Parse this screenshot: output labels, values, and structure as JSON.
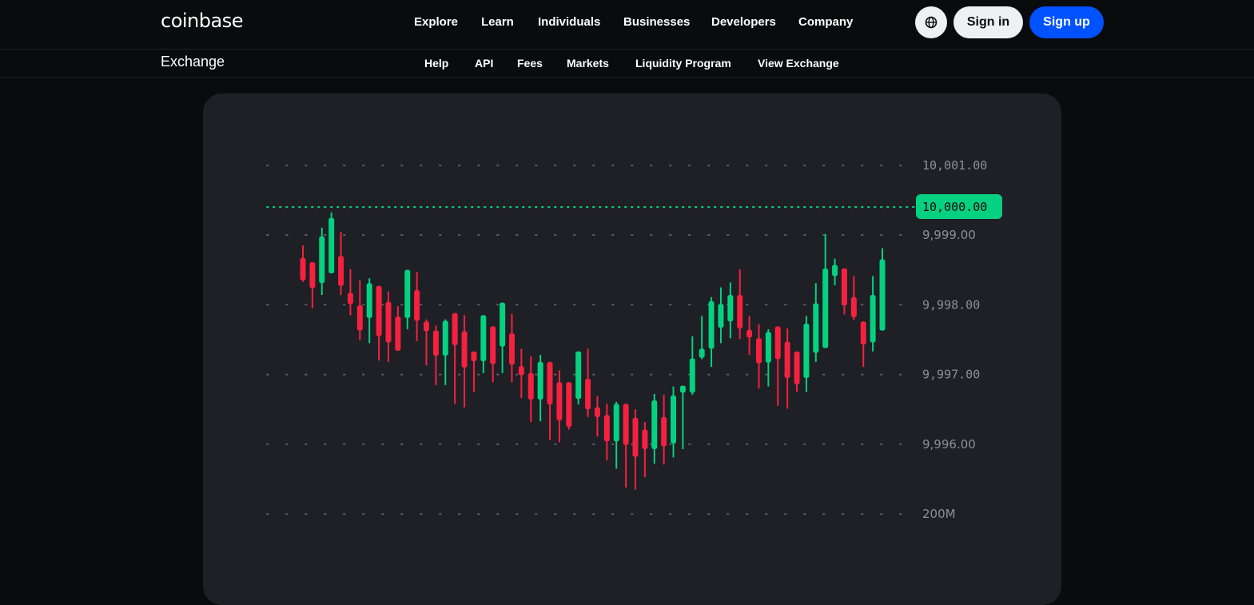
{
  "header": {
    "logo": "coinbase",
    "nav": [
      "Explore",
      "Learn",
      "Individuals",
      "Businesses",
      "Developers",
      "Company"
    ],
    "globe_icon": "globe-icon",
    "sign_in": "Sign in",
    "sign_up": "Sign up"
  },
  "subnav": {
    "title": "Exchange",
    "links": [
      "Help",
      "API",
      "Fees",
      "Markets",
      "Liquidity Program",
      "View Exchange"
    ]
  },
  "colors": {
    "up": "#05d180",
    "down": "#f5213f",
    "accent": "#0052ff",
    "price_marker": "#05d180"
  },
  "chart_data": {
    "type": "candlestick",
    "title": "",
    "yaxis_ticks": [
      {
        "value": 10001.0,
        "label": "10,001.00"
      },
      {
        "value": 9999.0,
        "label": "9,999.00"
      },
      {
        "value": 9998.0,
        "label": "9,998.00"
      },
      {
        "value": 9997.0,
        "label": "9,997.00"
      },
      {
        "value": 9996.0,
        "label": "9,996.00"
      },
      {
        "value": 9995.0,
        "label": "200M"
      }
    ],
    "current_price": {
      "value": 9999.4,
      "label": "10,000.00"
    },
    "ylim": [
      9994.8,
      10001.5
    ],
    "grid": "dotted",
    "candles": [
      {
        "o": 9998.67,
        "h": 9998.85,
        "l": 9998.33,
        "c": 9998.35
      },
      {
        "o": 9998.61,
        "h": 9998.61,
        "l": 9997.95,
        "c": 9998.24
      },
      {
        "o": 9998.31,
        "h": 9999.21,
        "l": 9998.14,
        "c": 9998.98
      },
      {
        "o": 9998.45,
        "h": 9999.65,
        "l": 9998.45,
        "c": 9999.49
      },
      {
        "o": 9998.7,
        "h": 9999.09,
        "l": 9998.14,
        "c": 9998.27
      },
      {
        "o": 9998.17,
        "h": 9998.51,
        "l": 9997.85,
        "c": 9998.01
      },
      {
        "o": 9997.99,
        "h": 9998.35,
        "l": 9997.49,
        "c": 9997.63
      },
      {
        "o": 9997.81,
        "h": 9998.38,
        "l": 9997.45,
        "c": 9998.31
      },
      {
        "o": 9998.27,
        "h": 9998.27,
        "l": 9997.2,
        "c": 9997.55
      },
      {
        "o": 9998.04,
        "h": 9998.19,
        "l": 9997.18,
        "c": 9997.46
      },
      {
        "o": 9997.83,
        "h": 9997.98,
        "l": 9997.42,
        "c": 9997.34
      },
      {
        "o": 9997.81,
        "h": 9998.41,
        "l": 9997.65,
        "c": 9998.5
      },
      {
        "o": 9998.21,
        "h": 9998.47,
        "l": 9997.48,
        "c": 9997.77
      },
      {
        "o": 9997.76,
        "h": 9997.79,
        "l": 9997.13,
        "c": 9997.62
      },
      {
        "o": 9997.63,
        "h": 9997.7,
        "l": 9996.85,
        "c": 9997.27
      },
      {
        "o": 9997.27,
        "h": 9997.79,
        "l": 9996.85,
        "c": 9997.77
      },
      {
        "o": 9997.88,
        "h": 9997.88,
        "l": 9996.58,
        "c": 9997.42
      },
      {
        "o": 9997.62,
        "h": 9997.85,
        "l": 9996.53,
        "c": 9997.1
      },
      {
        "o": 9997.33,
        "h": 9997.33,
        "l": 9996.75,
        "c": 9997.19
      },
      {
        "o": 9997.19,
        "h": 9997.81,
        "l": 9997.02,
        "c": 9997.85
      },
      {
        "o": 9997.69,
        "h": 9997.65,
        "l": 9996.89,
        "c": 9997.15
      },
      {
        "o": 9997.4,
        "h": 9998.0,
        "l": 9997.02,
        "c": 9998.03
      },
      {
        "o": 9997.59,
        "h": 9997.87,
        "l": 9996.89,
        "c": 9997.14
      },
      {
        "o": 9997.12,
        "h": 9997.37,
        "l": 9996.66,
        "c": 9996.99
      },
      {
        "o": 9997.02,
        "h": 9997.26,
        "l": 9996.32,
        "c": 9996.64
      },
      {
        "o": 9996.64,
        "h": 9997.28,
        "l": 9996.33,
        "c": 9997.18
      },
      {
        "o": 9997.18,
        "h": 9997.18,
        "l": 9996.06,
        "c": 9996.57
      },
      {
        "o": 9996.89,
        "h": 9997.06,
        "l": 9996.03,
        "c": 9996.34
      },
      {
        "o": 9996.89,
        "h": 9996.89,
        "l": 9996.21,
        "c": 9996.25
      },
      {
        "o": 9996.65,
        "h": 9997.3,
        "l": 9996.57,
        "c": 9997.33
      },
      {
        "o": 9996.94,
        "h": 9997.37,
        "l": 9996.39,
        "c": 9996.5
      },
      {
        "o": 9996.53,
        "h": 9996.69,
        "l": 9996.11,
        "c": 9996.39
      },
      {
        "o": 9996.42,
        "h": 9996.58,
        "l": 9995.77,
        "c": 9996.04
      },
      {
        "o": 9996.04,
        "h": 9996.61,
        "l": 9995.65,
        "c": 9996.58
      },
      {
        "o": 9996.58,
        "h": 9996.58,
        "l": 9995.38,
        "c": 9995.99
      },
      {
        "o": 9996.38,
        "h": 9996.5,
        "l": 9995.35,
        "c": 9995.82
      },
      {
        "o": 9996.21,
        "h": 9996.32,
        "l": 9995.53,
        "c": 9995.93
      },
      {
        "o": 9995.93,
        "h": 9996.72,
        "l": 9995.72,
        "c": 9996.63
      },
      {
        "o": 9996.39,
        "h": 9996.71,
        "l": 9995.71,
        "c": 9995.97
      },
      {
        "o": 9996.01,
        "h": 9996.83,
        "l": 9995.81,
        "c": 9996.7
      },
      {
        "o": 9996.74,
        "h": 9996.84,
        "l": 9995.93,
        "c": 9996.84
      },
      {
        "o": 9996.74,
        "h": 9997.55,
        "l": 9996.71,
        "c": 9997.23
      },
      {
        "o": 9997.24,
        "h": 9997.84,
        "l": 9997.22,
        "c": 9997.37
      },
      {
        "o": 9997.37,
        "h": 9998.11,
        "l": 9997.11,
        "c": 9998.05
      },
      {
        "o": 9997.67,
        "h": 9998.25,
        "l": 9997.45,
        "c": 9998.01
      },
      {
        "o": 9997.76,
        "h": 9998.32,
        "l": 9997.52,
        "c": 9998.14
      },
      {
        "o": 9998.14,
        "h": 9998.51,
        "l": 9997.51,
        "c": 9997.66
      },
      {
        "o": 9997.64,
        "h": 9997.84,
        "l": 9997.28,
        "c": 9997.53
      },
      {
        "o": 9997.52,
        "h": 9997.72,
        "l": 9996.8,
        "c": 9997.16
      },
      {
        "o": 9997.17,
        "h": 9997.65,
        "l": 9996.83,
        "c": 9997.61
      },
      {
        "o": 9997.69,
        "h": 9997.69,
        "l": 9996.55,
        "c": 9997.22
      },
      {
        "o": 9997.47,
        "h": 9997.66,
        "l": 9996.51,
        "c": 9996.95
      },
      {
        "o": 9997.33,
        "h": 9997.33,
        "l": 9996.75,
        "c": 9996.86
      },
      {
        "o": 9996.95,
        "h": 9997.84,
        "l": 9996.75,
        "c": 9997.73
      },
      {
        "o": 9997.31,
        "h": 9998.31,
        "l": 9997.18,
        "c": 9998.02
      },
      {
        "o": 9997.38,
        "h": 9999.03,
        "l": 9997.38,
        "c": 9998.52
      },
      {
        "o": 9998.41,
        "h": 9998.66,
        "l": 9998.28,
        "c": 9998.57
      },
      {
        "o": 9998.52,
        "h": 9998.52,
        "l": 9997.86,
        "c": 9997.99
      },
      {
        "o": 9998.11,
        "h": 9998.41,
        "l": 9997.78,
        "c": 9997.82
      },
      {
        "o": 9997.76,
        "h": 9997.76,
        "l": 9997.11,
        "c": 9997.43
      },
      {
        "o": 9997.46,
        "h": 9998.41,
        "l": 9997.33,
        "c": 9998.14
      },
      {
        "o": 9997.63,
        "h": 9998.81,
        "l": 9997.63,
        "c": 9998.65
      }
    ]
  }
}
